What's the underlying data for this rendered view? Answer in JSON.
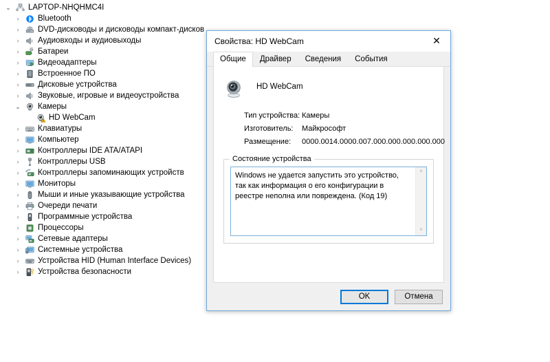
{
  "tree": {
    "root": {
      "label": "LAPTOP-NHQHMC4I",
      "icon": "computer-icon",
      "expanded": true
    },
    "items": [
      {
        "label": "Bluetooth",
        "icon": "bluetooth-icon",
        "expanded": false
      },
      {
        "label": "DVD-дисководы и дисководы компакт-дисков",
        "icon": "dvd-drive-icon",
        "expanded": false
      },
      {
        "label": "Аудиовходы и аудиовыходы",
        "icon": "audio-icon",
        "expanded": false
      },
      {
        "label": "Батареи",
        "icon": "battery-icon",
        "expanded": false
      },
      {
        "label": "Видеоадаптеры",
        "icon": "display-adapter-icon",
        "expanded": false
      },
      {
        "label": "Встроенное ПО",
        "icon": "firmware-icon",
        "expanded": false
      },
      {
        "label": "Дисковые устройства",
        "icon": "disk-drive-icon",
        "expanded": false
      },
      {
        "label": "Звуковые, игровые и видеоустройства",
        "icon": "sound-device-icon",
        "expanded": false
      },
      {
        "label": "Камеры",
        "icon": "camera-icon",
        "expanded": true
      },
      {
        "label": "HD WebCam",
        "icon": "webcam-warning-icon",
        "child": true
      },
      {
        "label": "Клавиатуры",
        "icon": "keyboard-icon",
        "expanded": false
      },
      {
        "label": "Компьютер",
        "icon": "monitor-icon",
        "expanded": false
      },
      {
        "label": "Контроллеры IDE ATA/ATAPI",
        "icon": "ide-controller-icon",
        "expanded": false
      },
      {
        "label": "Контроллеры USB",
        "icon": "usb-icon",
        "expanded": false
      },
      {
        "label": "Контроллеры запоминающих устройств",
        "icon": "storage-controller-icon",
        "expanded": false
      },
      {
        "label": "Мониторы",
        "icon": "monitor-icon",
        "expanded": false
      },
      {
        "label": "Мыши и иные указывающие устройства",
        "icon": "mouse-icon",
        "expanded": false
      },
      {
        "label": "Очереди печати",
        "icon": "printer-icon",
        "expanded": false
      },
      {
        "label": "Программные устройства",
        "icon": "software-device-icon",
        "expanded": false
      },
      {
        "label": "Процессоры",
        "icon": "processor-icon",
        "expanded": false
      },
      {
        "label": "Сетевые адаптеры",
        "icon": "network-adapter-icon",
        "expanded": false
      },
      {
        "label": "Системные устройства",
        "icon": "system-device-icon",
        "expanded": false
      },
      {
        "label": "Устройства HID (Human Interface Devices)",
        "icon": "hid-icon",
        "expanded": false
      },
      {
        "label": "Устройства безопасности",
        "icon": "security-device-icon",
        "expanded": false
      }
    ],
    "chevron_collapsed": "›",
    "chevron_expanded": "⌄"
  },
  "dialog": {
    "title": "Свойства: HD WebCam",
    "close_label": "✕",
    "tabs": [
      {
        "label": "Общие",
        "active": true
      },
      {
        "label": "Драйвер",
        "active": false
      },
      {
        "label": "Сведения",
        "active": false
      },
      {
        "label": "События",
        "active": false
      }
    ],
    "device_name": "HD WebCam",
    "info": [
      {
        "label": "Тип устройства:",
        "value": "Камеры"
      },
      {
        "label": "Изготовитель:",
        "value": "Майкрософт"
      },
      {
        "label": "Размещение:",
        "value": "0000.0014.0000.007.000.000.000.000.000"
      }
    ],
    "status_group_label": "Состояние устройства",
    "status_text": "Windows не удается запустить это устройство, так как информация о его конфигурации в реестре неполна или повреждена. (Код 19)",
    "scroll_up": "˄",
    "scroll_down": "˅",
    "buttons": {
      "ok": "OK",
      "cancel": "Отмена"
    }
  },
  "colors": {
    "accent": "#0078d7",
    "dialog_border": "#6fa8dc",
    "status_box_border": "#7bb0d6",
    "warning": "#ffc20e"
  }
}
